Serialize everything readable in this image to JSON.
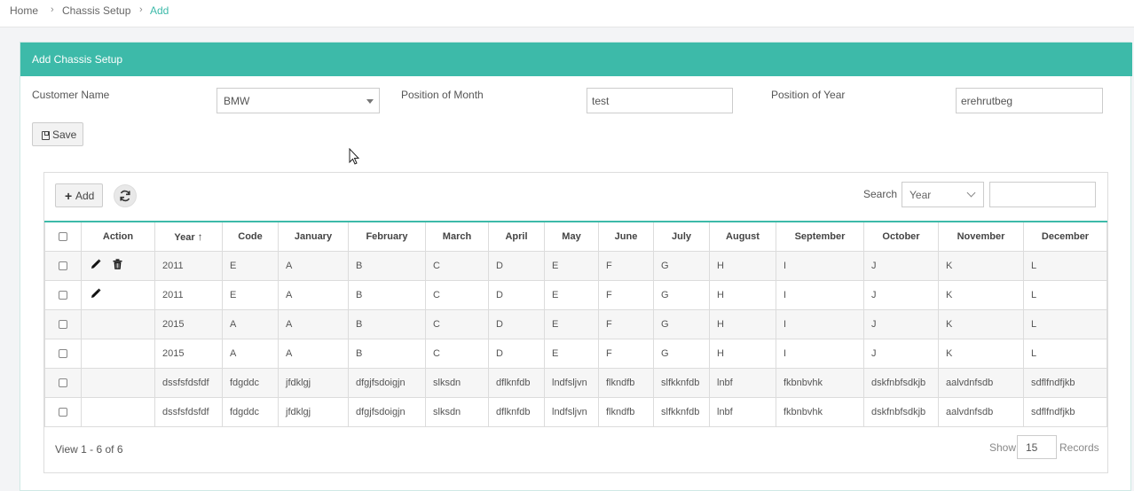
{
  "breadcrumb": {
    "items": [
      "Home",
      "Chassis Setup",
      "Add"
    ]
  },
  "panel": {
    "title": "Add Chassis Setup"
  },
  "form": {
    "customer_label": "Customer Name",
    "customer_value": "BMW",
    "month_label": "Position of Month",
    "month_value": "test",
    "year_label": "Position of Year",
    "year_value": "erehrutbeg",
    "save_label": "Save"
  },
  "toolbar": {
    "add_label": "Add",
    "search_label": "Search",
    "search_field": "Year",
    "search_value": ""
  },
  "table": {
    "columns": [
      "Action",
      "Year",
      "Code",
      "January",
      "February",
      "March",
      "April",
      "May",
      "June",
      "July",
      "August",
      "September",
      "October",
      "November",
      "December"
    ],
    "rows": [
      {
        "actions": [
          "edit",
          "delete"
        ],
        "cells": [
          "2011",
          "E",
          "A",
          "B",
          "C",
          "D",
          "E",
          "F",
          "G",
          "H",
          "I",
          "J",
          "K",
          "L"
        ]
      },
      {
        "actions": [
          "edit"
        ],
        "cells": [
          "2011",
          "E",
          "A",
          "B",
          "C",
          "D",
          "E",
          "F",
          "G",
          "H",
          "I",
          "J",
          "K",
          "L"
        ]
      },
      {
        "actions": [],
        "cells": [
          "2015",
          "A",
          "A",
          "B",
          "C",
          "D",
          "E",
          "F",
          "G",
          "H",
          "I",
          "J",
          "K",
          "L"
        ]
      },
      {
        "actions": [],
        "cells": [
          "2015",
          "A",
          "A",
          "B",
          "C",
          "D",
          "E",
          "F",
          "G",
          "H",
          "I",
          "J",
          "K",
          "L"
        ]
      },
      {
        "actions": [],
        "cells": [
          "dssfsfdsfdf",
          "fdgddc",
          "jfdklgj",
          "dfgjfsdoigjn",
          "slksdn",
          "dflknfdb",
          "lndfsljvn",
          "flkndfb",
          "slfkknfdb",
          "lnbf",
          "fkbnbvhk",
          "dskfnbfsdkjb",
          "aalvdnfsdb",
          "sdflfndfjkb"
        ]
      },
      {
        "actions": [],
        "cells": [
          "dssfsfdsfdf",
          "fdgddc",
          "jfdklgj",
          "dfgjfsdoigjn",
          "slksdn",
          "dflknfdb",
          "lndfsljvn",
          "flkndfb",
          "slfkknfdb",
          "lnbf",
          "fkbnbvhk",
          "dskfnbfsdkjb",
          "aalvdnfsdb",
          "sdflfndfjkb"
        ]
      }
    ]
  },
  "footer": {
    "view_text": "View 1 - 6 of 6",
    "show_label": "Show",
    "page_size": "15",
    "records_label": "Records"
  },
  "colors": {
    "accent": "#3dbaa9"
  }
}
